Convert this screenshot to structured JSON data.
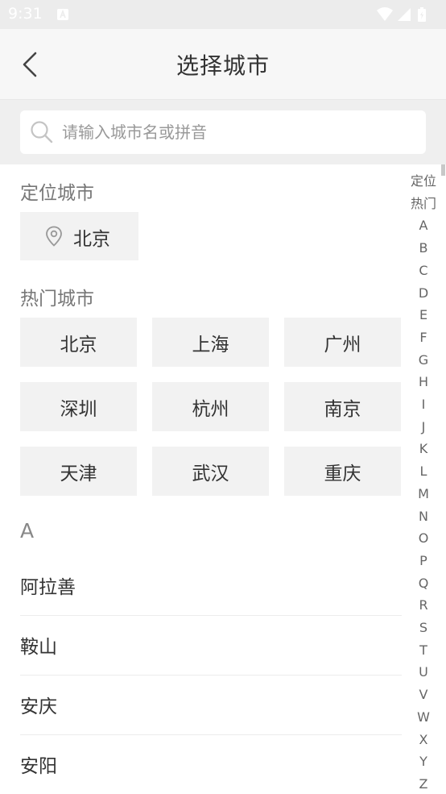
{
  "status_bar": {
    "time": "9:31"
  },
  "header": {
    "title": "选择城市"
  },
  "search": {
    "placeholder": "请输入城市名或拼音"
  },
  "location": {
    "label": "定位城市",
    "city": "北京"
  },
  "hot": {
    "label": "热门城市",
    "cities": [
      "北京",
      "上海",
      "广州",
      "深圳",
      "杭州",
      "南京",
      "天津",
      "武汉",
      "重庆"
    ]
  },
  "city_list": {
    "letter": "A",
    "cities": [
      "阿拉善",
      "鞍山",
      "安庆",
      "安阳"
    ]
  },
  "index_bar": {
    "items": [
      "定位",
      "热门",
      "A",
      "B",
      "C",
      "D",
      "E",
      "F",
      "G",
      "H",
      "I",
      "J",
      "K",
      "L",
      "M",
      "N",
      "O",
      "P",
      "Q",
      "R",
      "S",
      "T",
      "U",
      "V",
      "W",
      "X",
      "Y",
      "Z"
    ]
  }
}
